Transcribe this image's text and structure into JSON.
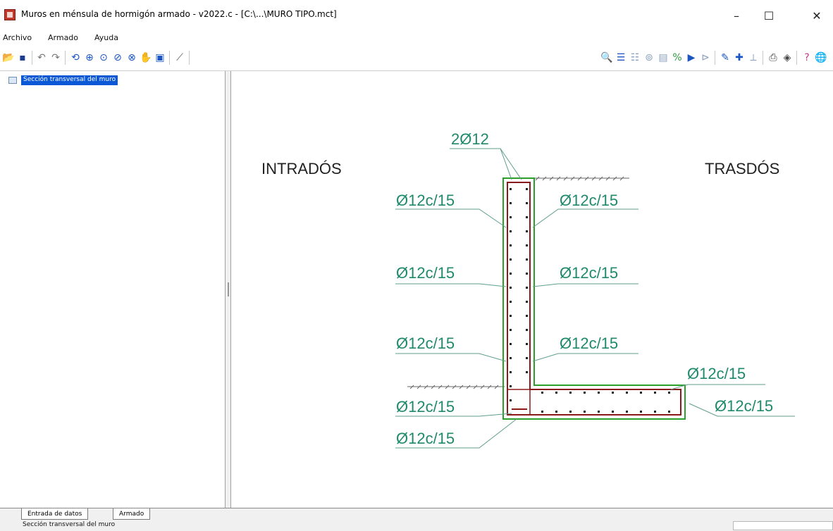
{
  "window": {
    "title": "Muros en ménsula de hormigón armado - v2022.c - [C:\\...\\MURO TIPO.mct]",
    "minimize": "–",
    "maximize": "☐",
    "close": "✕"
  },
  "menu": {
    "items": [
      {
        "label": "Archivo"
      },
      {
        "label": "Armado"
      },
      {
        "label": "Ayuda"
      }
    ]
  },
  "toolbar": {
    "left_icons": [
      "open-folder-icon",
      "save-icon",
      "undo-icon",
      "redo-icon",
      "redraw-icon",
      "zoom-all-icon",
      "zoom-window-icon",
      "zoom-previous-icon",
      "zoom-extent-icon",
      "pan-hand-icon",
      "view-options-icon",
      "measure-icon"
    ],
    "right_icons": [
      "search-icon",
      "list-icon",
      "list-alt-icon",
      "target-icon",
      "edit-box-icon",
      "percent-icon",
      "play-icon",
      "step-icon",
      "pencil-icon",
      "plus-icon",
      "dimension-icon",
      "print-icon",
      "print-preview-icon",
      "help-icon",
      "web-icon"
    ]
  },
  "tree": {
    "selected_item": "Sección transversal del muro"
  },
  "drawing": {
    "label_intrados": "INTRADÓS",
    "label_trasdos": "TRASDÓS",
    "top_bars": "2Ø12",
    "rebar_left_1": "Ø12c/15",
    "rebar_right_1": "Ø12c/15",
    "rebar_left_2": "Ø12c/15",
    "rebar_right_2": "Ø12c/15",
    "rebar_left_3": "Ø12c/15",
    "rebar_right_3": "Ø12c/15",
    "rebar_footing_top_right": "Ø12c/15",
    "rebar_footing_bottom_right": "Ø12c/15",
    "rebar_footing_left_1": "Ø12c/15",
    "rebar_footing_left_2": "Ø12c/15",
    "colors": {
      "label": "#1f8a6b",
      "concrete": "#2aa02a",
      "rebar": "#8b1a1a",
      "text": "#222222"
    }
  },
  "tabs": [
    {
      "label": "Entrada de datos"
    },
    {
      "label": "Armado"
    }
  ],
  "status": {
    "text": "Sección transversal del muro"
  }
}
